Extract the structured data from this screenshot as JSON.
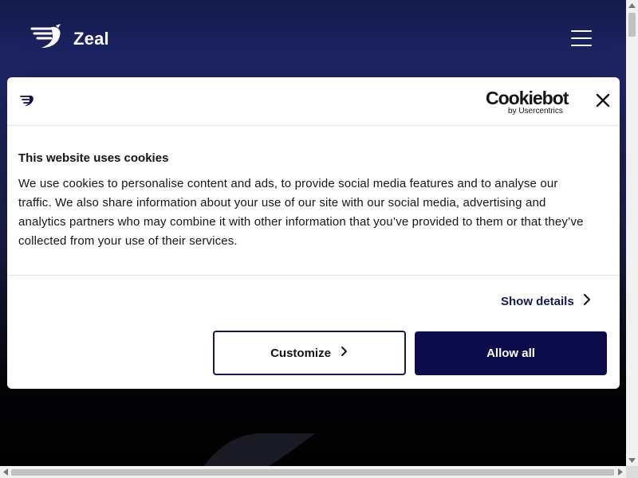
{
  "site": {
    "logo_text": "Zeal",
    "logo_icon": "zeal-bird-icon",
    "menu_icon": "hamburger-menu-icon"
  },
  "cookie_banner": {
    "brand_main": "Cookiebot",
    "brand_sub": "by Usercentrics",
    "close_icon": "close-icon",
    "title": "This website uses cookies",
    "text": "We use cookies to personalise content and ads, to provide social media features and to analyse our traffic. We also share information about your use of our site with our social media, advertising and analytics partners who may combine it with other information that you’ve provided to them or that they’ve collected from your use of their services.",
    "show_details_label": "Show details",
    "customize_label": "Customize",
    "allow_all_label": "Allow all"
  },
  "colors": {
    "brand_navy": "#0c0c4a",
    "header_gradient_top": "#141a4a",
    "text": "#141414"
  }
}
